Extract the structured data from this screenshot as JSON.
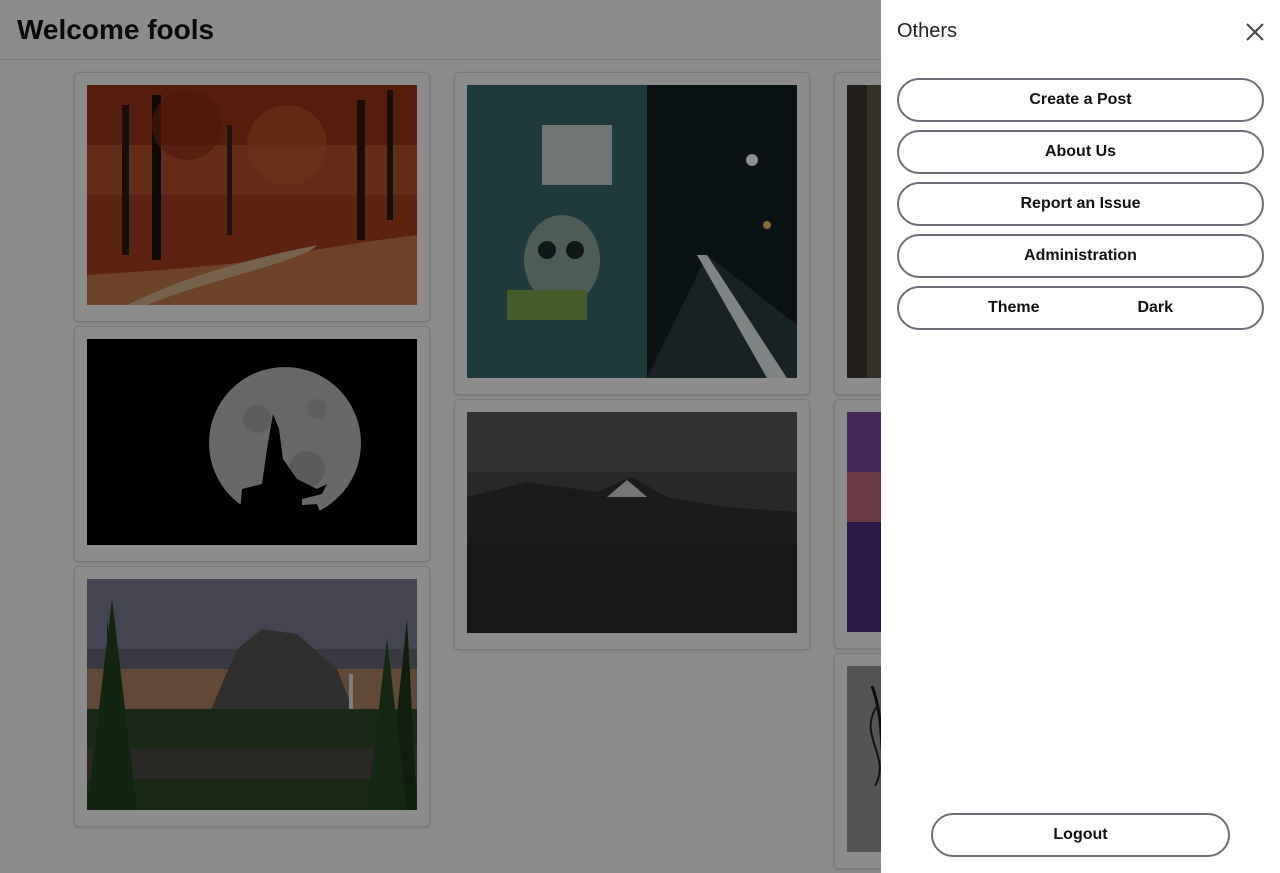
{
  "header": {
    "title": "Welcome fools"
  },
  "gallery": {
    "posts": [
      {
        "image": "autumn-forest-path-image"
      },
      {
        "image": "wolf-howling-at-moon-image"
      },
      {
        "image": "yosemite-mountain-river-image"
      },
      {
        "image": "graffiti-night-alley-image"
      },
      {
        "image": "mount-fuji-lake-image"
      },
      {
        "image": "forest-trees-image"
      },
      {
        "image": "city-sunset-skyline-image"
      },
      {
        "image": "black-white-sketch-image"
      }
    ]
  },
  "drawer": {
    "title": "Others",
    "items": [
      {
        "label": "Create a Post"
      },
      {
        "label": "About Us"
      },
      {
        "label": "Report an Issue"
      },
      {
        "label": "Administration"
      }
    ],
    "theme": {
      "label": "Theme",
      "value": "Dark"
    },
    "logout_label": "Logout"
  }
}
